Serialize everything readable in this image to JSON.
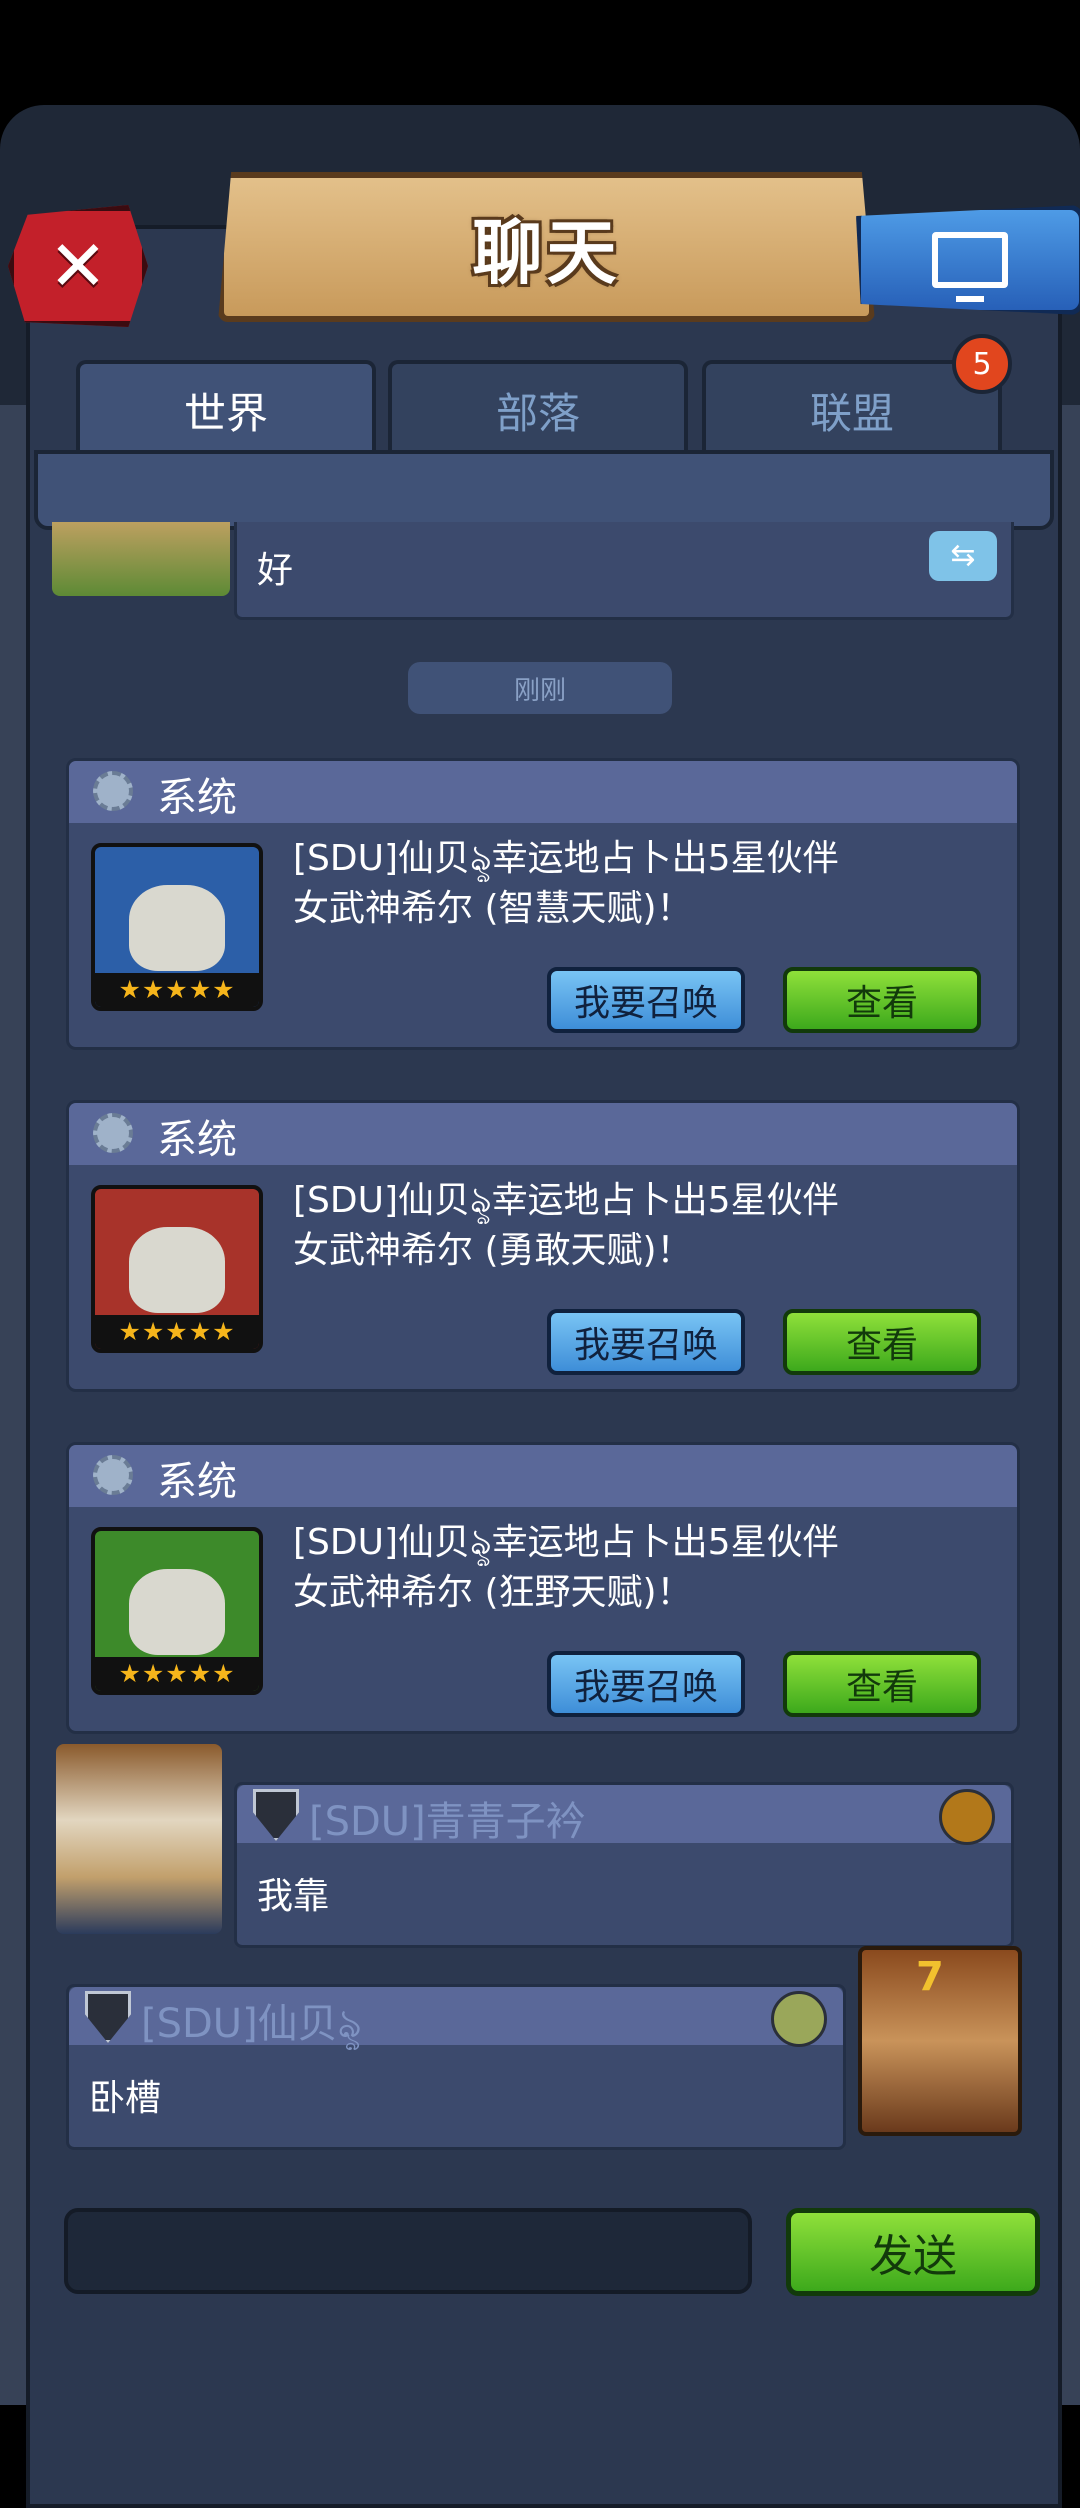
{
  "header": {
    "title": "聊天",
    "close_icon": "close-icon",
    "screen_icon": "monitor-icon"
  },
  "tabs": [
    {
      "label": "世界",
      "active": true
    },
    {
      "label": "部落",
      "active": false
    },
    {
      "label": "联盟",
      "active": false
    }
  ],
  "badge": {
    "count": "5"
  },
  "messages": {
    "first": {
      "text": "好"
    },
    "timestamp": "刚刚",
    "system_cards": [
      {
        "title": "系统",
        "line1": "[SDU]仙贝ৡ幸运地占卜出5星伙伴",
        "line2": "女武神希尔 (智慧天赋)！",
        "stars": "★★★★★",
        "summon_label": "我要召唤",
        "view_label": "查看",
        "hero_color": "#2c5fa8"
      },
      {
        "title": "系统",
        "line1": "[SDU]仙贝ৡ幸运地占卜出5星伙伴",
        "line2": "女武神希尔 (勇敢天赋)！",
        "stars": "★★★★★",
        "summon_label": "我要召唤",
        "view_label": "查看",
        "hero_color": "#a8332a"
      },
      {
        "title": "系统",
        "line1": "[SDU]仙贝ৡ幸运地占卜出5星伙伴",
        "line2": "女武神希尔 (狂野天赋)！",
        "stars": "★★★★★",
        "summon_label": "我要召唤",
        "view_label": "查看",
        "hero_color": "#3d8a2a"
      }
    ],
    "user1": {
      "name": "[SDU]青青子衿",
      "text": "我靠"
    },
    "user2": {
      "name": "[SDU]仙贝ৡ",
      "text": "卧槽",
      "avatar_number": "7"
    }
  },
  "composer": {
    "send_label": "发送"
  }
}
